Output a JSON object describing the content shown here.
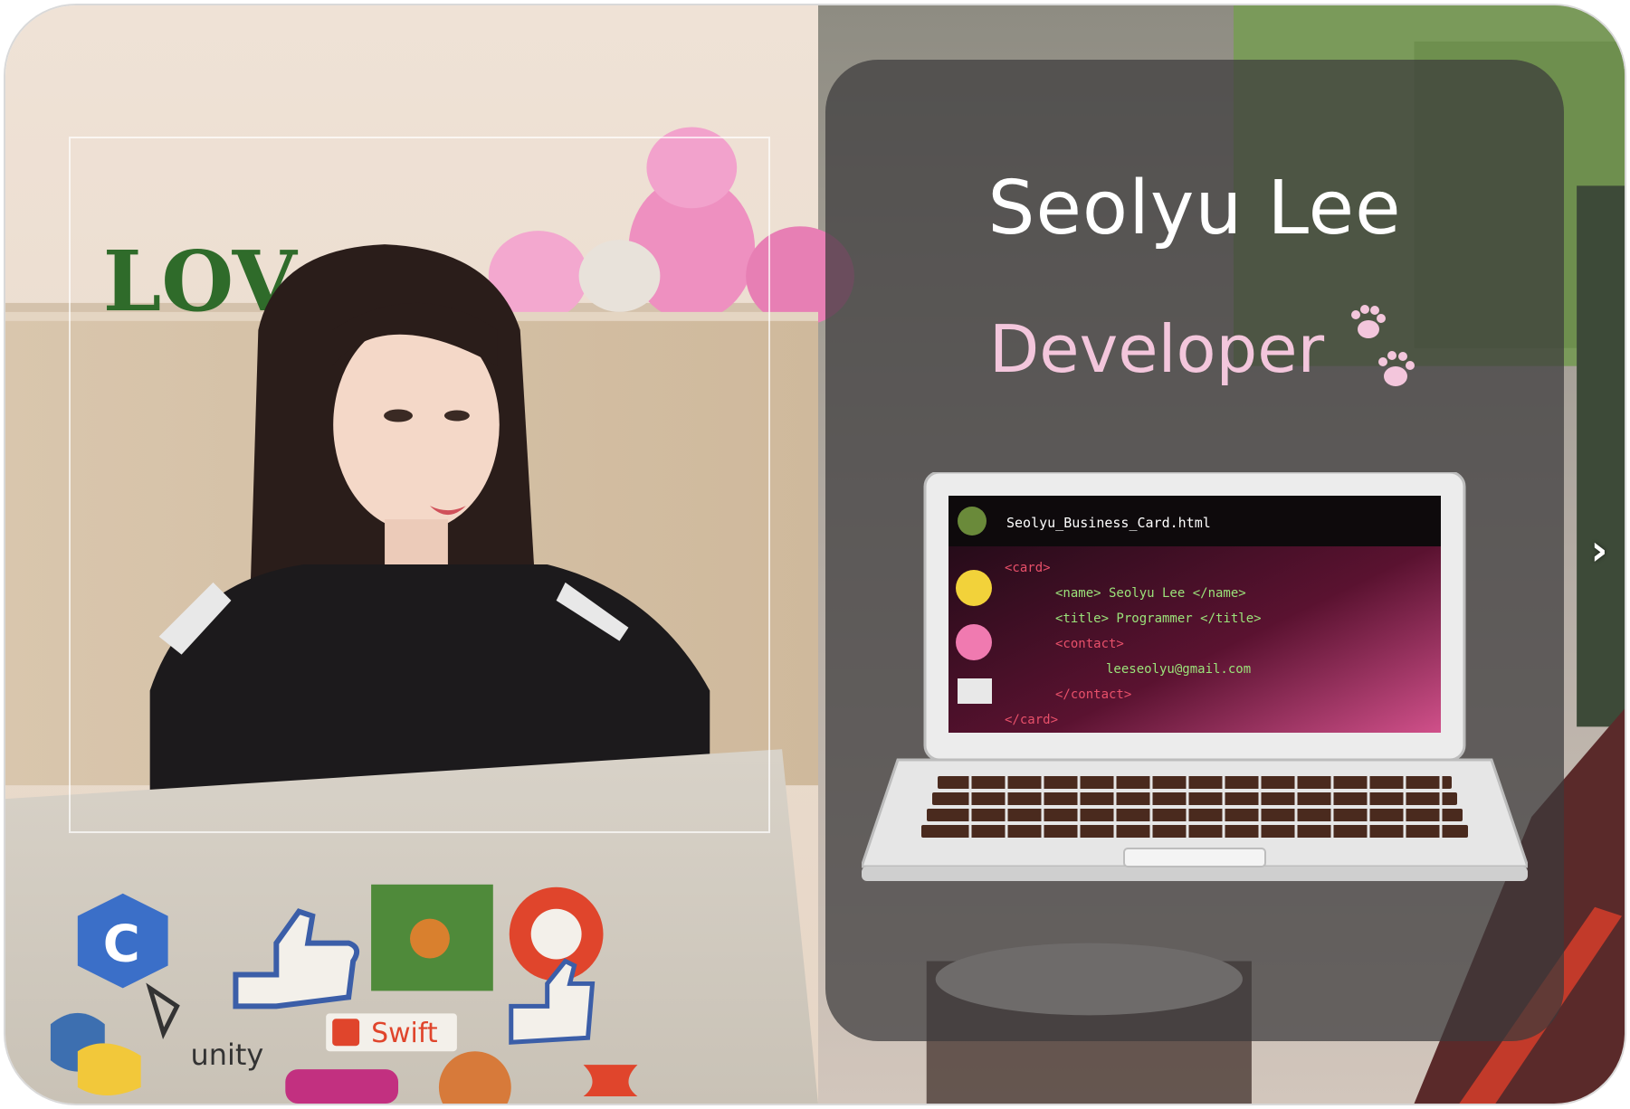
{
  "card": {
    "name": "Seolyu Lee",
    "role": "Developer"
  },
  "laptop_screen": {
    "filename": "Seolyu_Business_Card.html",
    "code_lines": [
      "<card>",
      "<name> Seolyu Lee </name>",
      "<title> Programmer </title>",
      "<contact>",
      "leeseolyu@gmail.com",
      "</contact>",
      "</card>"
    ]
  },
  "photo": {
    "wall_letters": "LOV",
    "stickers": {
      "unity_label": "unity",
      "swift_label": "Swift"
    }
  },
  "carousel": {
    "next_glyph": "›"
  },
  "colors": {
    "card_overlay": "#3c3a3c",
    "name_text": "#ffffff",
    "role_text": "#f3c6dc",
    "code_tag": "#e8506a",
    "code_value": "#9be37a"
  }
}
